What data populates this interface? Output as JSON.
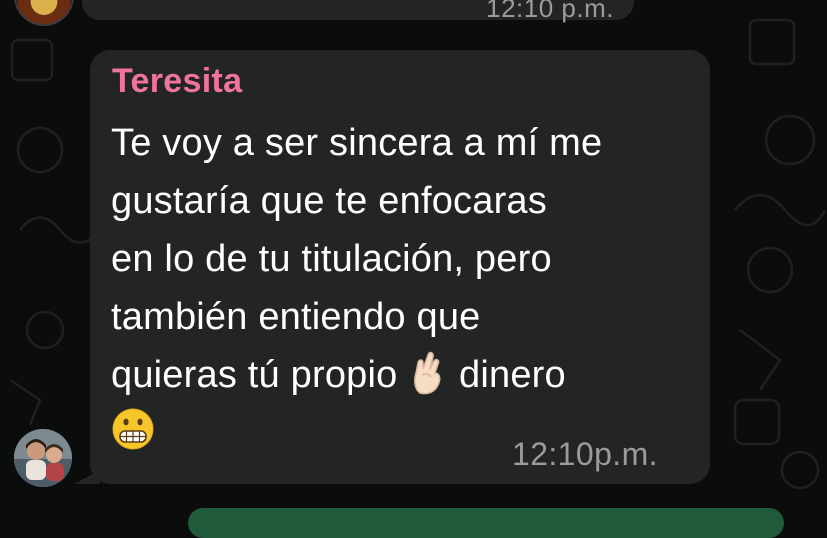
{
  "previous_message": {
    "time": "12:10 p.m."
  },
  "message": {
    "sender": "Teresita",
    "lines": [
      "Te voy a ser sincera a mí me",
      "gustaría que te enfocaras",
      "en lo de tu titulación, pero",
      "también entiendo que",
      "quieras tú propio",
      "dinero"
    ],
    "emoji_1": "crossed-fingers",
    "emoji_2": "grimacing-face",
    "time": "12:10p.m."
  },
  "colors": {
    "background": "#0b0c0c",
    "bubble": "#232524",
    "sender_name": "#f0739d",
    "text": "#ffffff",
    "timestamp": "#9a9c9b",
    "outgoing_bubble": "#1f5b3a"
  }
}
